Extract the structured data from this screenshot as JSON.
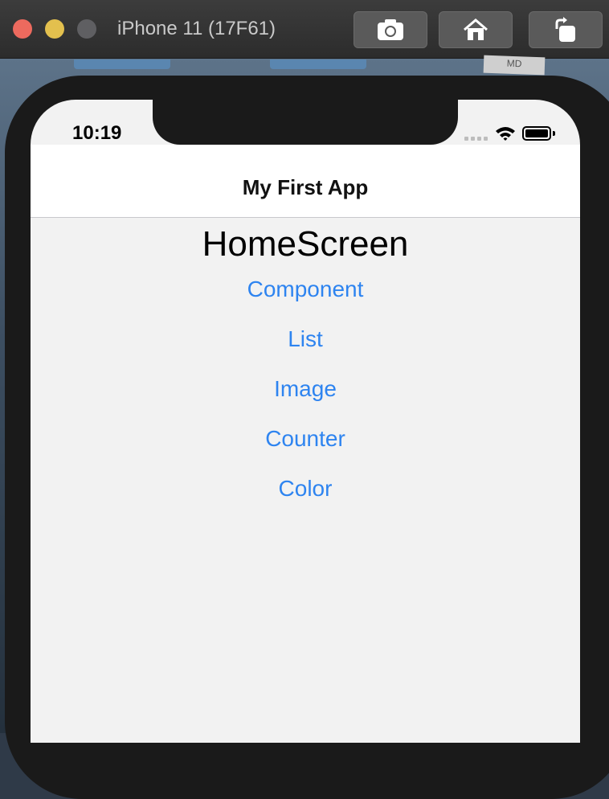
{
  "window": {
    "title": "iPhone 11 (17F61)",
    "buttons": [
      "screenshot-icon",
      "home-icon",
      "rotate-icon"
    ]
  },
  "desktop": {
    "md_label": "MD"
  },
  "status_bar": {
    "time": "10:19"
  },
  "nav": {
    "title": "My First App"
  },
  "screen": {
    "heading": "HomeScreen",
    "links": [
      {
        "label": "Component"
      },
      {
        "label": "List"
      },
      {
        "label": "Image"
      },
      {
        "label": "Counter"
      },
      {
        "label": "Color"
      }
    ],
    "link_color": "#2e84f0",
    "background": "#f2f2f2"
  }
}
